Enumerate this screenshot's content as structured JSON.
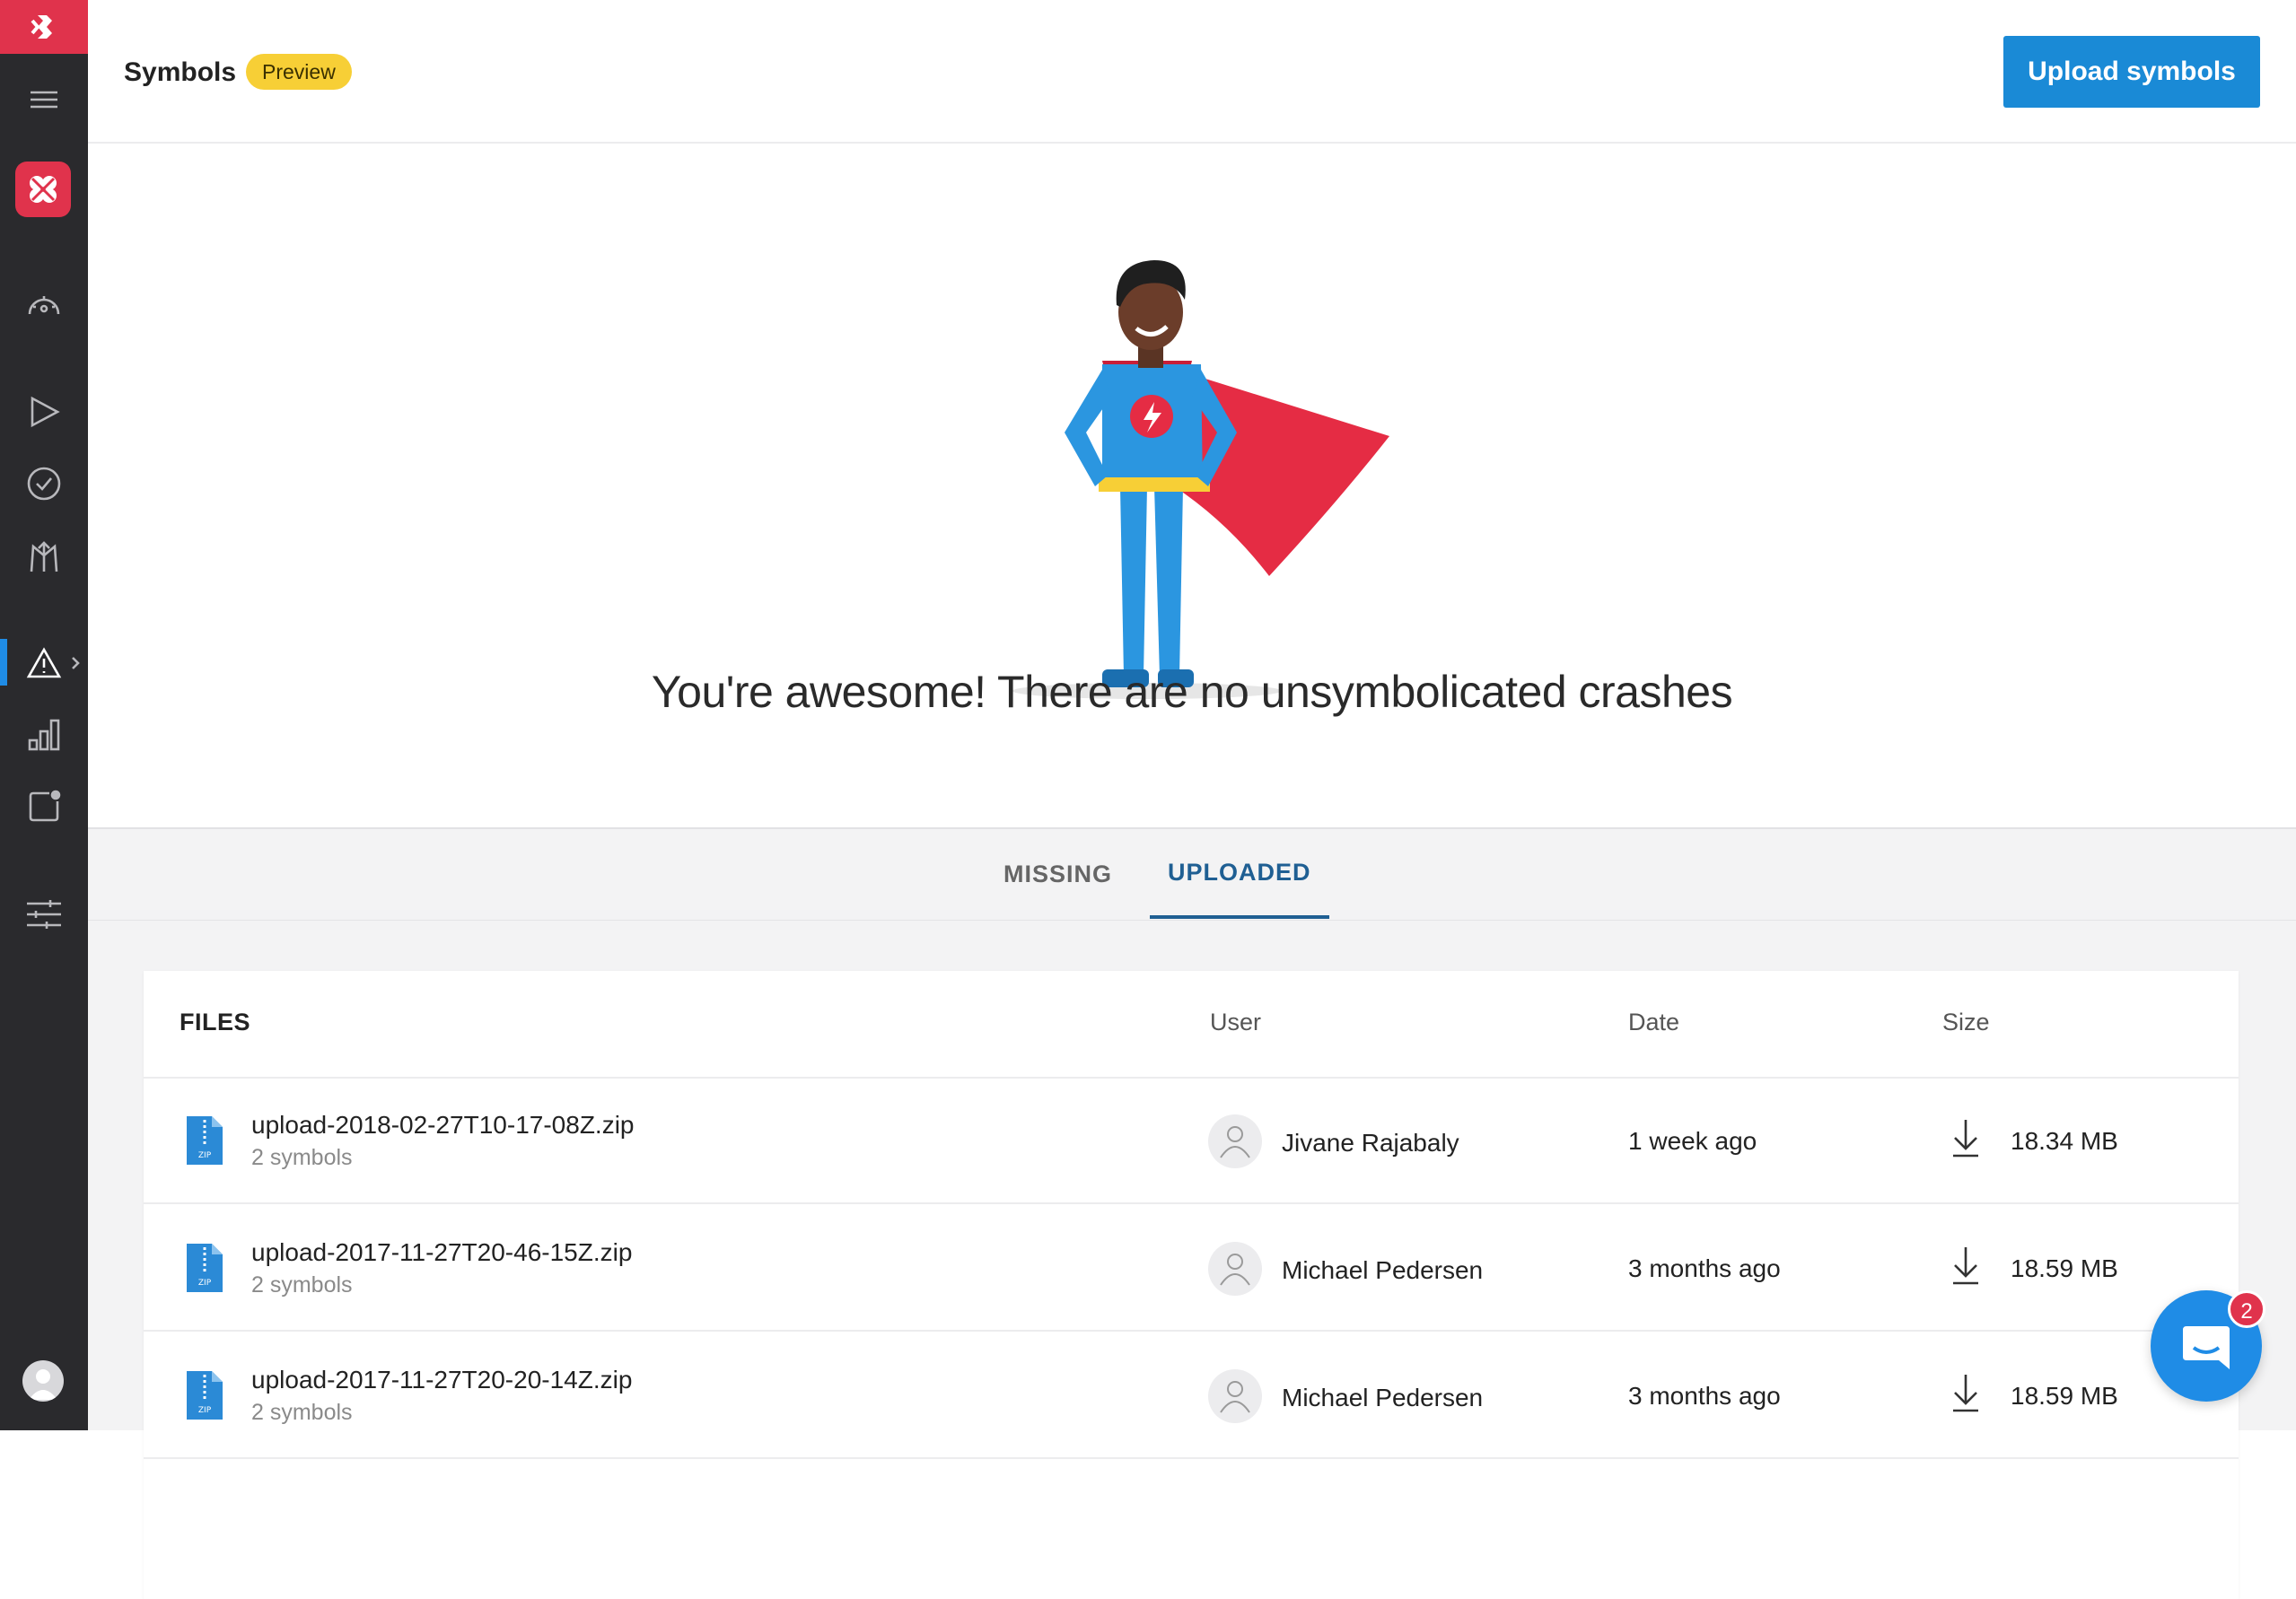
{
  "header": {
    "title": "Symbols",
    "badge": "Preview",
    "upload_button": "Upload symbols"
  },
  "hero": {
    "message": "You're awesome! There are no unsymbolicated crashes"
  },
  "tabs": [
    {
      "label": "MISSING",
      "active": false
    },
    {
      "label": "UPLOADED",
      "active": true
    }
  ],
  "table": {
    "columns": [
      "FILES",
      "User",
      "Date",
      "Size"
    ],
    "rows": [
      {
        "file": "upload-2018-02-27T10-17-08Z.zip",
        "symbols": "2 symbols",
        "user": "Jivane Rajabaly",
        "date": "1 week ago",
        "size": "18.34 MB"
      },
      {
        "file": "upload-2017-11-27T20-46-15Z.zip",
        "symbols": "2 symbols",
        "user": "Michael Pedersen",
        "date": "3 months ago",
        "size": "18.59 MB"
      },
      {
        "file": "upload-2017-11-27T20-20-14Z.zip",
        "symbols": "2 symbols",
        "user": "Michael Pedersen",
        "date": "3 months ago",
        "size": "18.59 MB"
      }
    ]
  },
  "sidebar": {
    "items": [
      {
        "name": "menu-icon"
      },
      {
        "name": "dashboard-gauge-icon"
      },
      {
        "name": "build-play-icon"
      },
      {
        "name": "test-check-icon"
      },
      {
        "name": "distribute-arrows-icon"
      },
      {
        "name": "diagnostics-warning-icon",
        "active": true
      },
      {
        "name": "analytics-bars-icon"
      },
      {
        "name": "push-notification-icon"
      },
      {
        "name": "settings-sliders-icon"
      }
    ]
  },
  "chat": {
    "badge_count": "2"
  },
  "colors": {
    "accent": "#1a8ad6",
    "brand": "#e0334c",
    "badge": "#f7cf36",
    "sidebar": "#2a2a2d"
  }
}
